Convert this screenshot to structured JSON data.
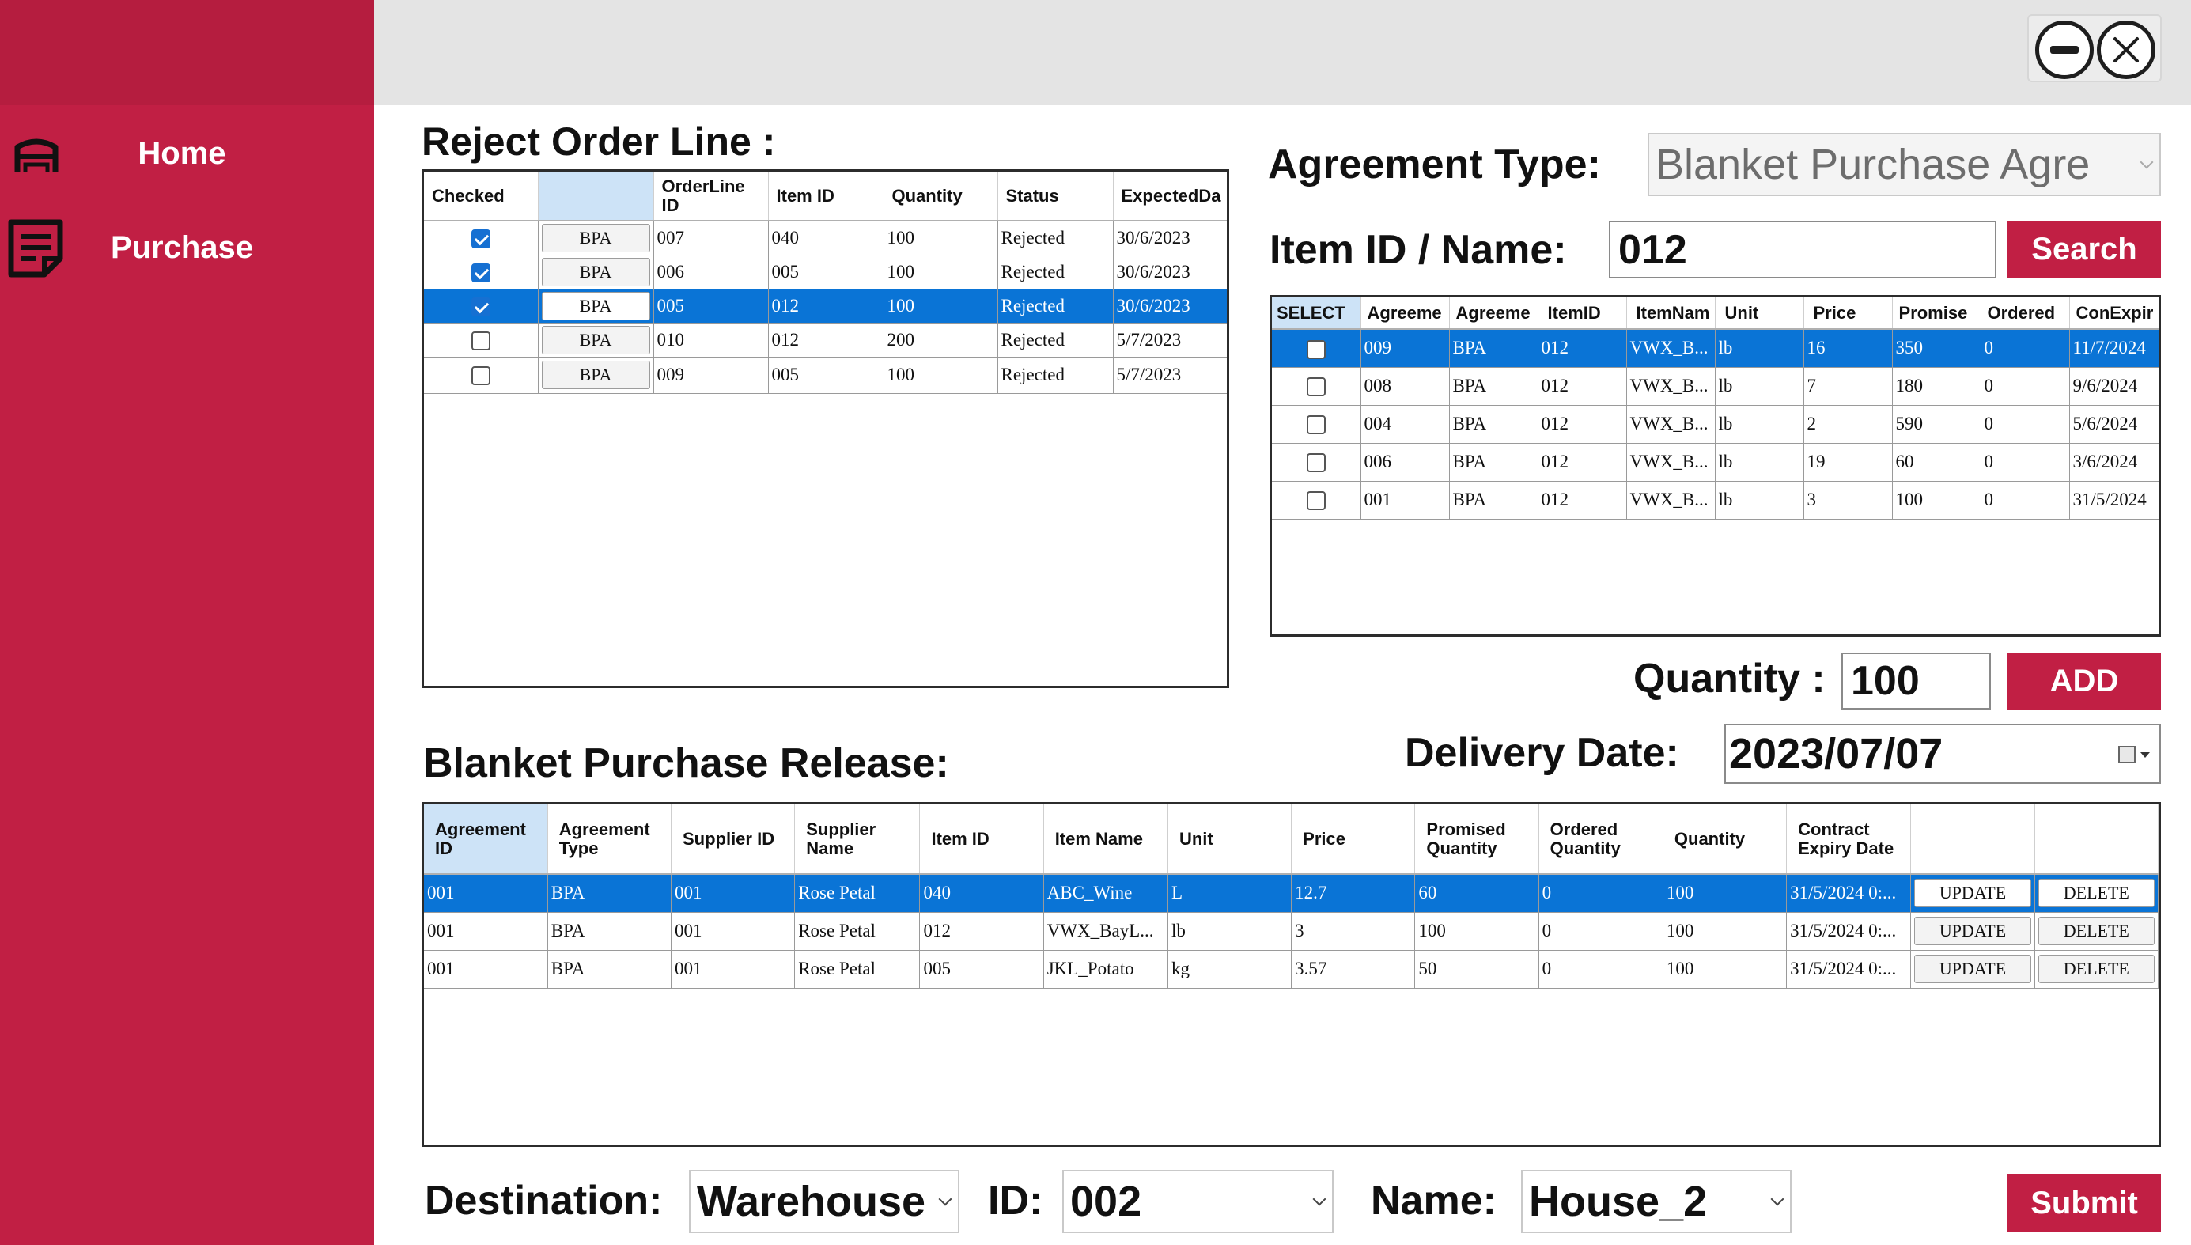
{
  "sidebar": {
    "items": [
      {
        "label": "Home",
        "icon": "home-icon"
      },
      {
        "label": "Purchase",
        "icon": "document-icon"
      }
    ]
  },
  "window": {
    "minimize_icon": "minimize-icon",
    "close_icon": "close-icon"
  },
  "reject": {
    "title": "Reject Order Line :",
    "columns": [
      "Checked",
      "",
      "OrderLine ID",
      "Item ID",
      "Quantity",
      "Status",
      "ExpectedDa"
    ],
    "rows": [
      {
        "checked": true,
        "btn": "BPA",
        "orderline": "007",
        "item": "040",
        "qty": "100",
        "status": "Rejected",
        "expected": "30/6/2023"
      },
      {
        "checked": true,
        "btn": "BPA",
        "orderline": "006",
        "item": "005",
        "qty": "100",
        "status": "Rejected",
        "expected": "30/6/2023"
      },
      {
        "checked": true,
        "btn": "BPA",
        "orderline": "005",
        "item": "012",
        "qty": "100",
        "status": "Rejected",
        "expected": "30/6/2023"
      },
      {
        "checked": false,
        "btn": "BPA",
        "orderline": "010",
        "item": "012",
        "qty": "200",
        "status": "Rejected",
        "expected": "5/7/2023"
      },
      {
        "checked": false,
        "btn": "BPA",
        "orderline": "009",
        "item": "005",
        "qty": "100",
        "status": "Rejected",
        "expected": "5/7/2023"
      }
    ]
  },
  "agreement": {
    "type_label": "Agreement Type:",
    "type_value": "Blanket Purchase Agre",
    "item_label": "Item ID / Name:",
    "item_value": "012",
    "search_label": "Search",
    "columns": [
      "SELECT",
      "Agreeme",
      "Agreeme",
      "ItemID",
      "ItemNam",
      "Unit",
      "Price",
      "Promise",
      "Ordered",
      "ConExpir"
    ],
    "rows": [
      {
        "id": "009",
        "type": "BPA",
        "item": "012",
        "name": "VWX_B...",
        "unit": "lb",
        "price": "16",
        "promised": "350",
        "ordered": "0",
        "expiry": "11/7/2024"
      },
      {
        "id": "008",
        "type": "BPA",
        "item": "012",
        "name": "VWX_B...",
        "unit": "lb",
        "price": "7",
        "promised": "180",
        "ordered": "0",
        "expiry": "9/6/2024"
      },
      {
        "id": "004",
        "type": "BPA",
        "item": "012",
        "name": "VWX_B...",
        "unit": "lb",
        "price": "2",
        "promised": "590",
        "ordered": "0",
        "expiry": "5/6/2024"
      },
      {
        "id": "006",
        "type": "BPA",
        "item": "012",
        "name": "VWX_B...",
        "unit": "lb",
        "price": "19",
        "promised": "60",
        "ordered": "0",
        "expiry": "3/6/2024"
      },
      {
        "id": "001",
        "type": "BPA",
        "item": "012",
        "name": "VWX_B...",
        "unit": "lb",
        "price": "3",
        "promised": "100",
        "ordered": "0",
        "expiry": "31/5/2024"
      }
    ],
    "quantity_label": "Quantity :",
    "quantity_value": "100",
    "add_label": "ADD",
    "delivery_label": "Delivery Date:",
    "delivery_value": "2023/07/07"
  },
  "release": {
    "title": "Blanket Purchase Release:",
    "columns": [
      "Agreement ID",
      "Agreement Type",
      "Supplier ID",
      "Supplier Name",
      "Item ID",
      "Item Name",
      "Unit",
      "Price",
      "Promised Quantity",
      "Ordered Quantity",
      "Quantity",
      "Contract Expiry Date",
      "",
      ""
    ],
    "rows": [
      {
        "agr": "001",
        "type": "BPA",
        "sup": "001",
        "supname": "Rose Petal",
        "item": "040",
        "itemname": "ABC_Wine",
        "unit": "L",
        "price": "12.7",
        "promised": "60",
        "ordered": "0",
        "qty": "100",
        "expiry": "31/5/2024 0:...",
        "update": "UPDATE",
        "delete": "DELETE"
      },
      {
        "agr": "001",
        "type": "BPA",
        "sup": "001",
        "supname": "Rose Petal",
        "item": "012",
        "itemname": "VWX_BayL...",
        "unit": "lb",
        "price": "3",
        "promised": "100",
        "ordered": "0",
        "qty": "100",
        "expiry": "31/5/2024 0:...",
        "update": "UPDATE",
        "delete": "DELETE"
      },
      {
        "agr": "001",
        "type": "BPA",
        "sup": "001",
        "supname": "Rose Petal",
        "item": "005",
        "itemname": "JKL_Potato",
        "unit": "kg",
        "price": "3.57",
        "promised": "50",
        "ordered": "0",
        "qty": "100",
        "expiry": "31/5/2024 0:...",
        "update": "UPDATE",
        "delete": "DELETE"
      }
    ]
  },
  "footer": {
    "destination_label": "Destination:",
    "destination_value": "Warehouse",
    "id_label": "ID:",
    "id_value": "002",
    "name_label": "Name:",
    "name_value": "House_2",
    "submit_label": "Submit"
  },
  "colors": {
    "brand": "#c11f44",
    "selection": "#0a74d6",
    "topbar": "#e4e4e4"
  }
}
